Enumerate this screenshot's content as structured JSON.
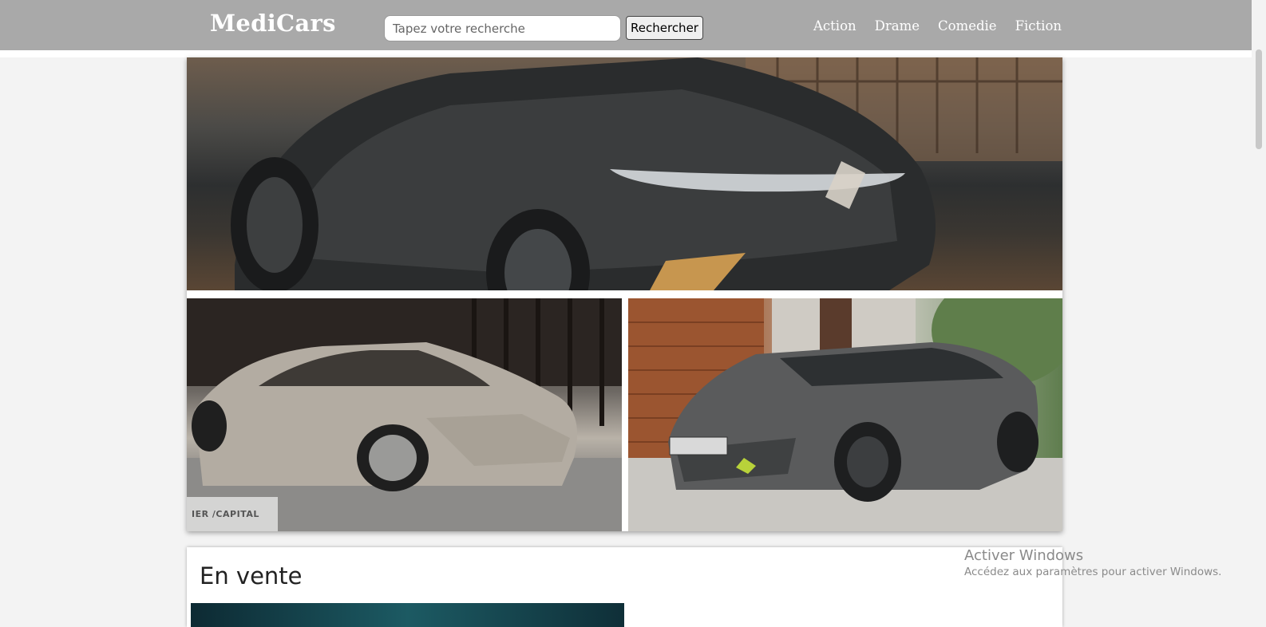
{
  "header": {
    "logo": "MediCars",
    "search": {
      "placeholder": "Tapez votre recherche",
      "value": ""
    },
    "search_button": "Rechercher",
    "nav": [
      "Action",
      "Drame",
      "Comedie",
      "Fiction"
    ]
  },
  "hero": {
    "images": [
      {
        "name": "renault-electric-car-photo"
      },
      {
        "name": "ds-sedan-photo",
        "overlay_text": "IER /CAPITAL"
      },
      {
        "name": "peugeot-wagon-photo"
      }
    ]
  },
  "main": {
    "section_title": "En vente"
  },
  "os_watermark": {
    "title": "Activer Windows",
    "subtitle": "Accédez aux paramètres pour activer Windows."
  },
  "colors": {
    "header_bg": "#a9a9a9",
    "page_bg": "#f3f3f3"
  }
}
